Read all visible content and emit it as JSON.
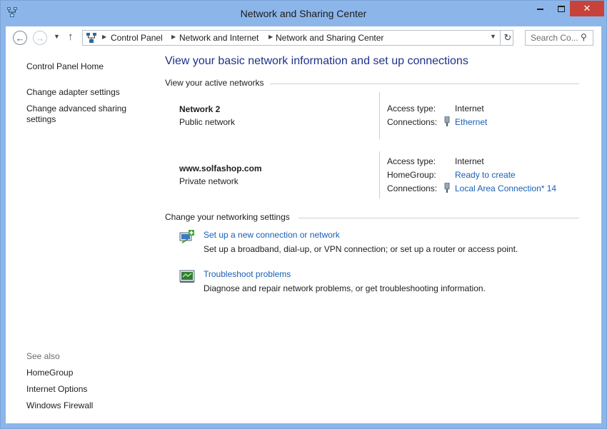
{
  "window": {
    "title": "Network and Sharing Center",
    "minimize_glyph": "▭",
    "maximize_glyph": "□",
    "close_glyph": "✕"
  },
  "address": {
    "crumbs": [
      "Control Panel",
      "Network and Internet",
      "Network and Sharing Center"
    ],
    "search_placeholder": "Search Co..."
  },
  "sidebar": {
    "home": "Control Panel Home",
    "links": [
      "Change adapter settings",
      "Change advanced sharing settings"
    ],
    "see_also_title": "See also",
    "see_also": [
      "HomeGroup",
      "Internet Options",
      "Windows Firewall"
    ]
  },
  "main": {
    "heading": "View your basic network information and set up connections",
    "active_networks_title": "View your active networks",
    "networks": [
      {
        "name": "Network  2",
        "category": "Public network",
        "access_type_label": "Access type:",
        "access_type": "Internet",
        "connections_label": "Connections:",
        "connection": "Ethernet"
      },
      {
        "name": "www.solfashop.com",
        "category": "Private network",
        "access_type_label": "Access type:",
        "access_type": "Internet",
        "homegroup_label": "HomeGroup:",
        "homegroup": "Ready to create",
        "connections_label": "Connections:",
        "connection": "Local Area Connection* 14"
      }
    ],
    "settings_title": "Change your networking settings",
    "tasks": [
      {
        "link": "Set up a new connection or network",
        "description": "Set up a broadband, dial-up, or VPN connection; or set up a router or access point."
      },
      {
        "link": "Troubleshoot problems",
        "description": "Diagnose and repair network problems, or get troubleshooting information."
      }
    ]
  },
  "icons": {
    "window": "network-center-icon",
    "back": "back-arrow-icon",
    "forward": "forward-arrow-icon",
    "up": "up-arrow-icon",
    "refresh": "refresh-icon",
    "search": "search-icon",
    "connection": "ethernet-plug-icon",
    "new_connection": "new-connection-icon",
    "troubleshoot": "troubleshoot-icon"
  },
  "colors": {
    "titlebar": "#8cb6ea",
    "close_button": "#c7423a",
    "heading": "#1e3287",
    "link": "#1a5fb4"
  }
}
